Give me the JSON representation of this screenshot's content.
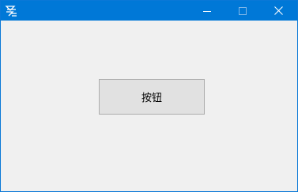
{
  "window": {
    "title": "",
    "accent_color": "#0078d7",
    "background_color": "#f0f0f0",
    "app_icon": "app-logo-icon",
    "controls": {
      "minimize_icon": "minimize-icon",
      "maximize_icon": "maximize-icon",
      "close_icon": "close-icon"
    }
  },
  "main": {
    "button_label": "按钮"
  }
}
